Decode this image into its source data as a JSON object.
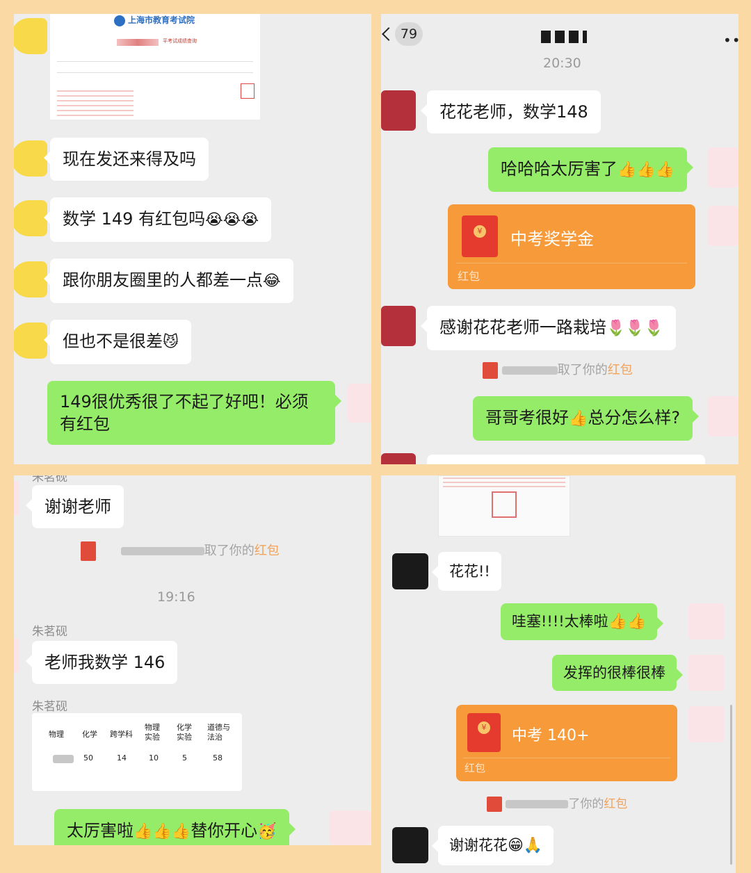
{
  "panel1": {
    "doc_header": "上海市教育考试院",
    "doc_subtitle": "平考试成绩查询",
    "messages": [
      {
        "text": "现在发还来得及吗"
      },
      {
        "text": "数学 149 有红包吗",
        "emoji": "😭😭😭"
      },
      {
        "text": "跟你朋友圈里的人都差一点",
        "emoji": "😂"
      },
      {
        "text": "但也不是很差",
        "emoji": "😼"
      }
    ],
    "reply": {
      "text": "149很优秀很了不起了好吧！必须有红包"
    }
  },
  "panel2": {
    "header": {
      "unread": "79",
      "time": "20:30"
    },
    "messages": [
      {
        "text": "花花老师，数学148"
      },
      {
        "text": "哈哈哈太厉害了",
        "emoji": "👍👍👍"
      },
      {
        "text": "感谢花花老师一路栽培",
        "emoji": "🌷🌷🌷"
      },
      {
        "text": "哥哥考很好",
        "emoji": "👍",
        "text2": "总分怎么样?"
      }
    ],
    "packet": {
      "title": "中考奖学金",
      "foot": "红包"
    },
    "system": {
      "prefix": "取了你的",
      "highlight": "红包"
    }
  },
  "panel3": {
    "name_top": "朱茗砚",
    "msg1": "谢谢老师",
    "system": {
      "prefix": "取了你的",
      "highlight": "红包"
    },
    "time": "19:16",
    "name": "朱茗砚",
    "msg2": "老师我数学 146",
    "table": {
      "headers": [
        "物理",
        "化学",
        "跨学科",
        "物理实验",
        "化学实验",
        "道德与法治"
      ],
      "values": [
        "50",
        "14",
        "10",
        "5",
        "58"
      ]
    },
    "reply": {
      "text": "太厉害啦",
      "emoji": "👍👍👍",
      "text2": "替你开心",
      "emoji2": "🥳"
    }
  },
  "panel4": {
    "messages": [
      {
        "text": "花花!!"
      },
      {
        "text": "哇塞!!!!太棒啦",
        "emoji": "👍👍"
      },
      {
        "text": "发挥的很棒很棒"
      },
      {
        "text": "谢谢花花",
        "emoji": "😁🙏"
      }
    ],
    "packet": {
      "title": "中考 140+",
      "foot": "红包"
    },
    "system": {
      "prefix": "了你的",
      "highlight": "红包"
    }
  }
}
